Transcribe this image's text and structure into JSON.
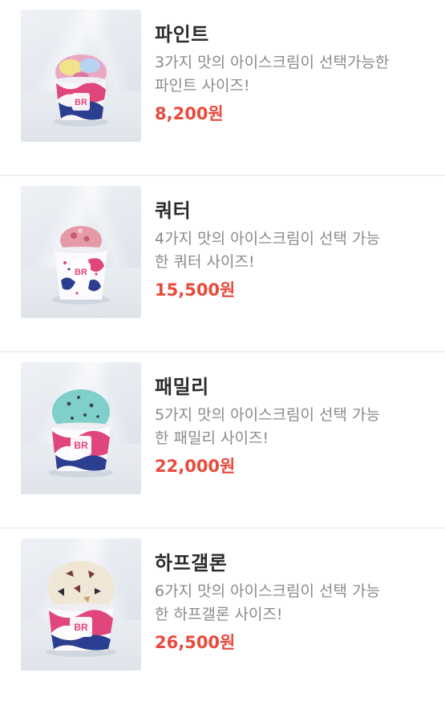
{
  "products": [
    {
      "name": "파인트",
      "desc_line1": "3가지 맛의 아이스크림이 선택가능한",
      "desc_line2": "파인트 사이즈!",
      "price": "8,200원",
      "scoop_color": "#e9a9c4",
      "scoop_accent": "#f2e38a",
      "cup_icon": "pint-cup-icon"
    },
    {
      "name": "쿼터",
      "desc_line1": "4가지 맛의 아이스크림이 선택 가능",
      "desc_line2": "한 쿼터 사이즈!",
      "price": "15,500원",
      "scoop_color": "#e69aa8",
      "scoop_accent": "#c85a73",
      "cup_icon": "quarter-cup-icon"
    },
    {
      "name": "패밀리",
      "desc_line1": "5가지 맛의 아이스크림이 선택 가능",
      "desc_line2": "한 패밀리 사이즈!",
      "price": "22,000원",
      "scoop_color": "#7fcfca",
      "scoop_accent": "#3a4a4a",
      "cup_icon": "family-cup-icon"
    },
    {
      "name": "하프갤론",
      "desc_line1": "6가지 맛의 아이스크림이 선택 가능",
      "desc_line2": "한 하프갤론 사이즈!",
      "price": "26,500원",
      "scoop_color": "#efe6d6",
      "scoop_accent": "#7a3a3a",
      "cup_icon": "half-gallon-cup-icon"
    }
  ],
  "colors": {
    "price": "#e84b3c",
    "title": "#2b2b2b",
    "desc": "#8a8a8a",
    "cup_pink": "#e0457b",
    "cup_navy": "#2c3e8f",
    "divider": "#f0f0f0"
  },
  "logo_text": "BR"
}
